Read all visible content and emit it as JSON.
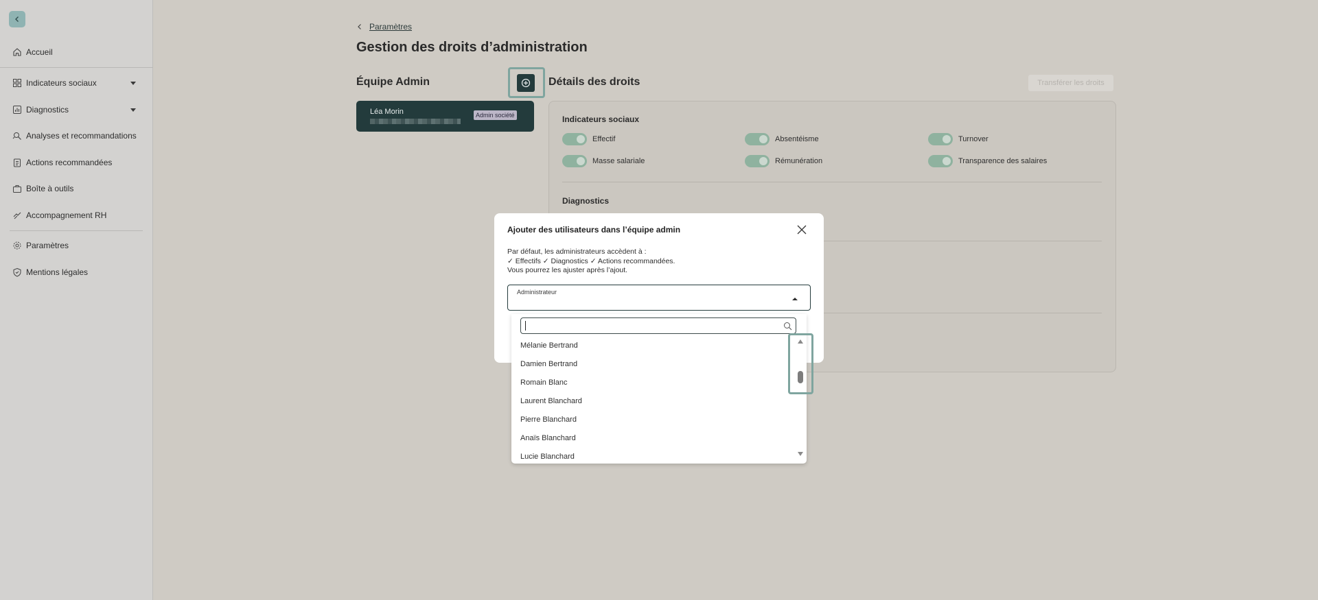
{
  "sidebar": {
    "items": [
      {
        "label": "Accueil",
        "icon": "home-icon"
      },
      {
        "label": "Indicateurs sociaux",
        "icon": "grid-icon"
      },
      {
        "label": "Diagnostics",
        "icon": "bar-chart-icon"
      },
      {
        "label": "Analyses et recommandations",
        "icon": "analysis-icon"
      },
      {
        "label": "Actions recommandées",
        "icon": "clipboard-icon"
      },
      {
        "label": "Boîte à outils",
        "icon": "toolbox-icon"
      },
      {
        "label": "Accompagnement RH",
        "icon": "handshake-icon"
      },
      {
        "label": "Paramètres",
        "icon": "gear-icon"
      },
      {
        "label": "Mentions légales",
        "icon": "shield-icon"
      }
    ]
  },
  "breadcrumb": {
    "label": "Paramètres"
  },
  "page": {
    "title": "Gestion des droits d’administration"
  },
  "team": {
    "title": "Équipe Admin",
    "members": [
      {
        "name": "Léa Morin",
        "badge": "Admin société"
      }
    ]
  },
  "details": {
    "title": "Détails des droits",
    "transfer_label": "Transférer les droits",
    "sections": [
      {
        "title": "Indicateurs sociaux",
        "toggles": [
          "Effectif",
          "Absentéisme",
          "Turnover",
          "Masse salariale",
          "Rémunération",
          "Transparence des salaires"
        ]
      },
      {
        "title": "Diagnostics"
      }
    ]
  },
  "modal": {
    "title": "Ajouter des utilisateurs dans l’équipe admin",
    "line1": "Par défaut, les administrateurs accèdent à :",
    "line2": "✓ Effectifs ✓ Diagnostics ✓ Actions recommandées.",
    "line3": "Vous pourrez les ajuster après l’ajout.",
    "select_label": "Administrateur",
    "search_value": "",
    "options": [
      "Mélanie Bertrand",
      "Damien Bertrand",
      "Romain Blanc",
      "Laurent Blanchard",
      "Pierre Blanchard",
      "Anaïs Blanchard",
      "Lucie Blanchard"
    ]
  },
  "colors": {
    "accent_dark": "#243b3c",
    "toggle_on": "#8fb29f",
    "highlight": "#7fa59f"
  }
}
